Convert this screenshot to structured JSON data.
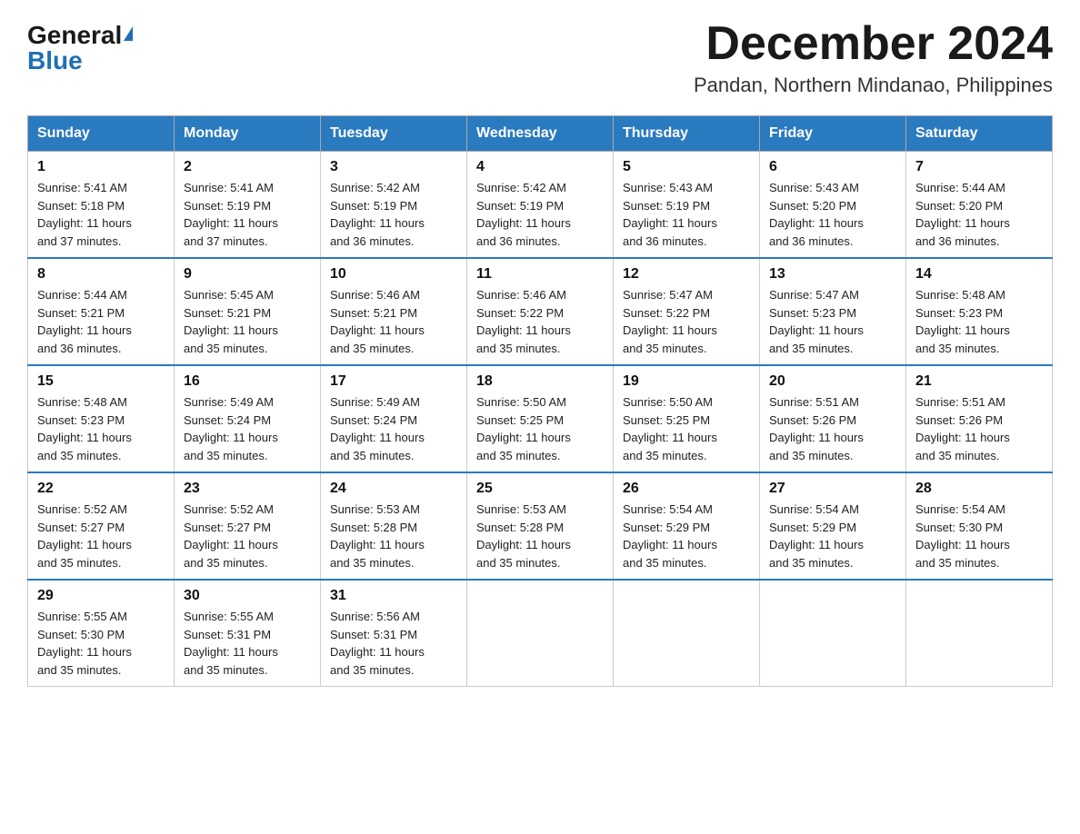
{
  "logo": {
    "general": "General",
    "blue": "Blue"
  },
  "title": {
    "month": "December 2024",
    "location": "Pandan, Northern Mindanao, Philippines"
  },
  "weekdays": [
    "Sunday",
    "Monday",
    "Tuesday",
    "Wednesday",
    "Thursday",
    "Friday",
    "Saturday"
  ],
  "weeks": [
    [
      {
        "day": "1",
        "sunrise": "5:41 AM",
        "sunset": "5:18 PM",
        "daylight": "11 hours and 37 minutes."
      },
      {
        "day": "2",
        "sunrise": "5:41 AM",
        "sunset": "5:19 PM",
        "daylight": "11 hours and 37 minutes."
      },
      {
        "day": "3",
        "sunrise": "5:42 AM",
        "sunset": "5:19 PM",
        "daylight": "11 hours and 36 minutes."
      },
      {
        "day": "4",
        "sunrise": "5:42 AM",
        "sunset": "5:19 PM",
        "daylight": "11 hours and 36 minutes."
      },
      {
        "day": "5",
        "sunrise": "5:43 AM",
        "sunset": "5:19 PM",
        "daylight": "11 hours and 36 minutes."
      },
      {
        "day": "6",
        "sunrise": "5:43 AM",
        "sunset": "5:20 PM",
        "daylight": "11 hours and 36 minutes."
      },
      {
        "day": "7",
        "sunrise": "5:44 AM",
        "sunset": "5:20 PM",
        "daylight": "11 hours and 36 minutes."
      }
    ],
    [
      {
        "day": "8",
        "sunrise": "5:44 AM",
        "sunset": "5:21 PM",
        "daylight": "11 hours and 36 minutes."
      },
      {
        "day": "9",
        "sunrise": "5:45 AM",
        "sunset": "5:21 PM",
        "daylight": "11 hours and 35 minutes."
      },
      {
        "day": "10",
        "sunrise": "5:46 AM",
        "sunset": "5:21 PM",
        "daylight": "11 hours and 35 minutes."
      },
      {
        "day": "11",
        "sunrise": "5:46 AM",
        "sunset": "5:22 PM",
        "daylight": "11 hours and 35 minutes."
      },
      {
        "day": "12",
        "sunrise": "5:47 AM",
        "sunset": "5:22 PM",
        "daylight": "11 hours and 35 minutes."
      },
      {
        "day": "13",
        "sunrise": "5:47 AM",
        "sunset": "5:23 PM",
        "daylight": "11 hours and 35 minutes."
      },
      {
        "day": "14",
        "sunrise": "5:48 AM",
        "sunset": "5:23 PM",
        "daylight": "11 hours and 35 minutes."
      }
    ],
    [
      {
        "day": "15",
        "sunrise": "5:48 AM",
        "sunset": "5:23 PM",
        "daylight": "11 hours and 35 minutes."
      },
      {
        "day": "16",
        "sunrise": "5:49 AM",
        "sunset": "5:24 PM",
        "daylight": "11 hours and 35 minutes."
      },
      {
        "day": "17",
        "sunrise": "5:49 AM",
        "sunset": "5:24 PM",
        "daylight": "11 hours and 35 minutes."
      },
      {
        "day": "18",
        "sunrise": "5:50 AM",
        "sunset": "5:25 PM",
        "daylight": "11 hours and 35 minutes."
      },
      {
        "day": "19",
        "sunrise": "5:50 AM",
        "sunset": "5:25 PM",
        "daylight": "11 hours and 35 minutes."
      },
      {
        "day": "20",
        "sunrise": "5:51 AM",
        "sunset": "5:26 PM",
        "daylight": "11 hours and 35 minutes."
      },
      {
        "day": "21",
        "sunrise": "5:51 AM",
        "sunset": "5:26 PM",
        "daylight": "11 hours and 35 minutes."
      }
    ],
    [
      {
        "day": "22",
        "sunrise": "5:52 AM",
        "sunset": "5:27 PM",
        "daylight": "11 hours and 35 minutes."
      },
      {
        "day": "23",
        "sunrise": "5:52 AM",
        "sunset": "5:27 PM",
        "daylight": "11 hours and 35 minutes."
      },
      {
        "day": "24",
        "sunrise": "5:53 AM",
        "sunset": "5:28 PM",
        "daylight": "11 hours and 35 minutes."
      },
      {
        "day": "25",
        "sunrise": "5:53 AM",
        "sunset": "5:28 PM",
        "daylight": "11 hours and 35 minutes."
      },
      {
        "day": "26",
        "sunrise": "5:54 AM",
        "sunset": "5:29 PM",
        "daylight": "11 hours and 35 minutes."
      },
      {
        "day": "27",
        "sunrise": "5:54 AM",
        "sunset": "5:29 PM",
        "daylight": "11 hours and 35 minutes."
      },
      {
        "day": "28",
        "sunrise": "5:54 AM",
        "sunset": "5:30 PM",
        "daylight": "11 hours and 35 minutes."
      }
    ],
    [
      {
        "day": "29",
        "sunrise": "5:55 AM",
        "sunset": "5:30 PM",
        "daylight": "11 hours and 35 minutes."
      },
      {
        "day": "30",
        "sunrise": "5:55 AM",
        "sunset": "5:31 PM",
        "daylight": "11 hours and 35 minutes."
      },
      {
        "day": "31",
        "sunrise": "5:56 AM",
        "sunset": "5:31 PM",
        "daylight": "11 hours and 35 minutes."
      },
      null,
      null,
      null,
      null
    ]
  ],
  "labels": {
    "sunrise": "Sunrise:",
    "sunset": "Sunset:",
    "daylight": "Daylight:"
  }
}
